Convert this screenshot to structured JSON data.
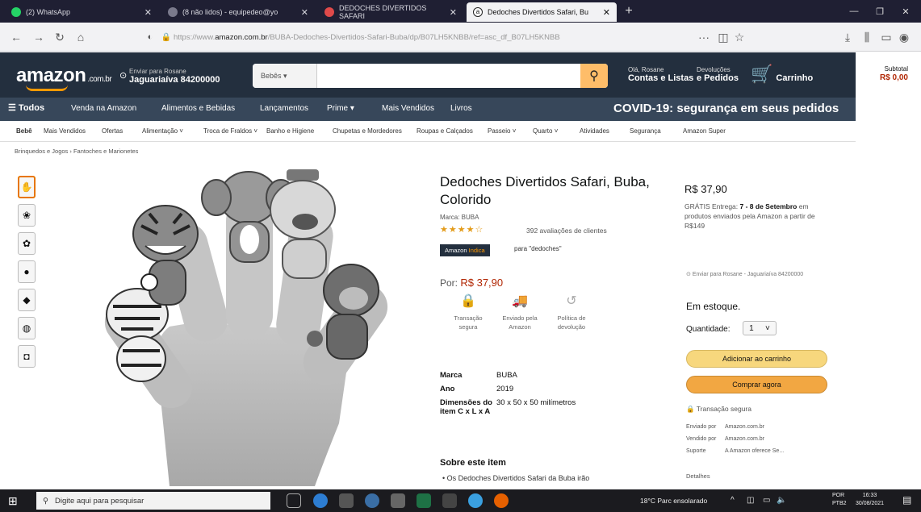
{
  "browser": {
    "tabs": [
      {
        "label": "(2) WhatsApp",
        "color": "#25d366"
      },
      {
        "label": "(8 não lidos) - equipedeo@yo",
        "color": "#7a7a8c"
      },
      {
        "label": "DEDOCHES DIVERTIDOS SAFARI",
        "color": "#e04a4a"
      },
      {
        "label": "Dedoches Divertidos Safari, Bu",
        "color": "#222222"
      }
    ],
    "new_tab": "+",
    "url_prefix": "https://www.",
    "url_domain": "amazon.com.br",
    "url_path": "/BUBA-Dedoches-Divertidos-Safari-Buba/dp/B07LH5KNBB/ref=asc_df_B07LH5KNBB",
    "url_more": "···"
  },
  "header": {
    "logo": "amazon",
    "logo_suffix": ".com.br",
    "deliver_line1": "Enviar para Rosane",
    "deliver_line2": "Jaguariaíva 84200000",
    "search_category": "Bebês ▾",
    "account_line1": "Olá, Rosane",
    "account_line2": "Contas e Listas",
    "returns_line1": "Devoluções",
    "returns_line2": "e Pedidos",
    "cart_label": "Carrinho",
    "cart_count": "0",
    "subtotal_label": "Subtotal",
    "subtotal_value": "R$ 0,00"
  },
  "navbelt": {
    "all": "Todos",
    "items": [
      "Venda na Amazon",
      "Alimentos e Bebidas",
      "Lançamentos",
      "Prime",
      "Mais Vendidos",
      "Livros"
    ],
    "covid": "COVID-19: segurança em seus pedidos"
  },
  "subnav": {
    "items": [
      "Bebê",
      "Mais Vendidos",
      "Ofertas",
      "Alimentação",
      "Troca de Fraldos",
      "Banho e Higiene",
      "Chupetas e Mordedores",
      "Roupas e Calçados",
      "Passeio",
      "Quarto",
      "Atividades",
      "Segurança",
      "Amazon Super"
    ]
  },
  "breadcrumb": "Brinquedos e Jogos › Fantoches e Marionetes",
  "product": {
    "title": "Dedoches Divertidos Safari, Buba, Colorido",
    "brand": "Marca: BUBA",
    "stars": "★★★★☆",
    "rating": 4.5,
    "reviews": "392 avaliações de clientes",
    "choice_badge": "Amazon",
    "choice_badge_suffix": "Indica",
    "choice_for": "para \"dedoches\"",
    "price_label": "Por:",
    "price": "R$ 37,90",
    "features": [
      {
        "icon": "lock-icon",
        "glyph": "🔒",
        "label": "Transação segura"
      },
      {
        "icon": "truck-icon",
        "glyph": "🚚",
        "label": "Enviado pela Amazon"
      },
      {
        "icon": "return-icon",
        "glyph": "↺",
        "label": "Política de devolução"
      }
    ],
    "specs": [
      {
        "key": "Marca",
        "value": "BUBA"
      },
      {
        "key": "Ano",
        "value": "2019"
      },
      {
        "key": "Dimensões do item C x L x A",
        "value": "30 x 50 x 50 milímetros"
      }
    ],
    "about_heading": "Sobre este item",
    "about_first": "• Os Dedoches Divertidos Safari da Buba irão"
  },
  "buybox": {
    "price": "R$ 37,90",
    "ship_prefix": "GRÁTIS Entrega:",
    "ship_dates": "7 - 8 de Setembro",
    "ship_suffix": "em produtos enviados pela Amazon a partir de R$149",
    "deliver_to": "Enviar para Rosane - Jaguariaíva 84200000",
    "stock": "Em estoque.",
    "qty_label": "Quantidade:",
    "qty_value": "1",
    "add_to_cart": "Adicionar ao carrinho",
    "buy_now": "Comprar agora",
    "secure": "Transação segura",
    "sold_rows": [
      {
        "k": "Enviado por",
        "v": "Amazon.com.br"
      },
      {
        "k": "Vendido por",
        "v": "Amazon.com.br"
      },
      {
        "k": "Suporte",
        "v": "A Amazon oferece Se..."
      }
    ],
    "details": "Detalhes"
  },
  "taskbar": {
    "search_placeholder": "Digite aqui para pesquisar",
    "weather": "18°C  Parc ensolarado",
    "lang1": "POR",
    "lang2": "PTB2",
    "time": "16:33",
    "date": "30/08/2021"
  },
  "colors": {
    "amazon_dark": "#232f3e",
    "amazon_belt": "#37475a",
    "amazon_orange": "#ff9900",
    "price_red": "#b12704",
    "add_cart_yellow": "#f7d77d",
    "buy_now_orange": "#f2a742"
  }
}
